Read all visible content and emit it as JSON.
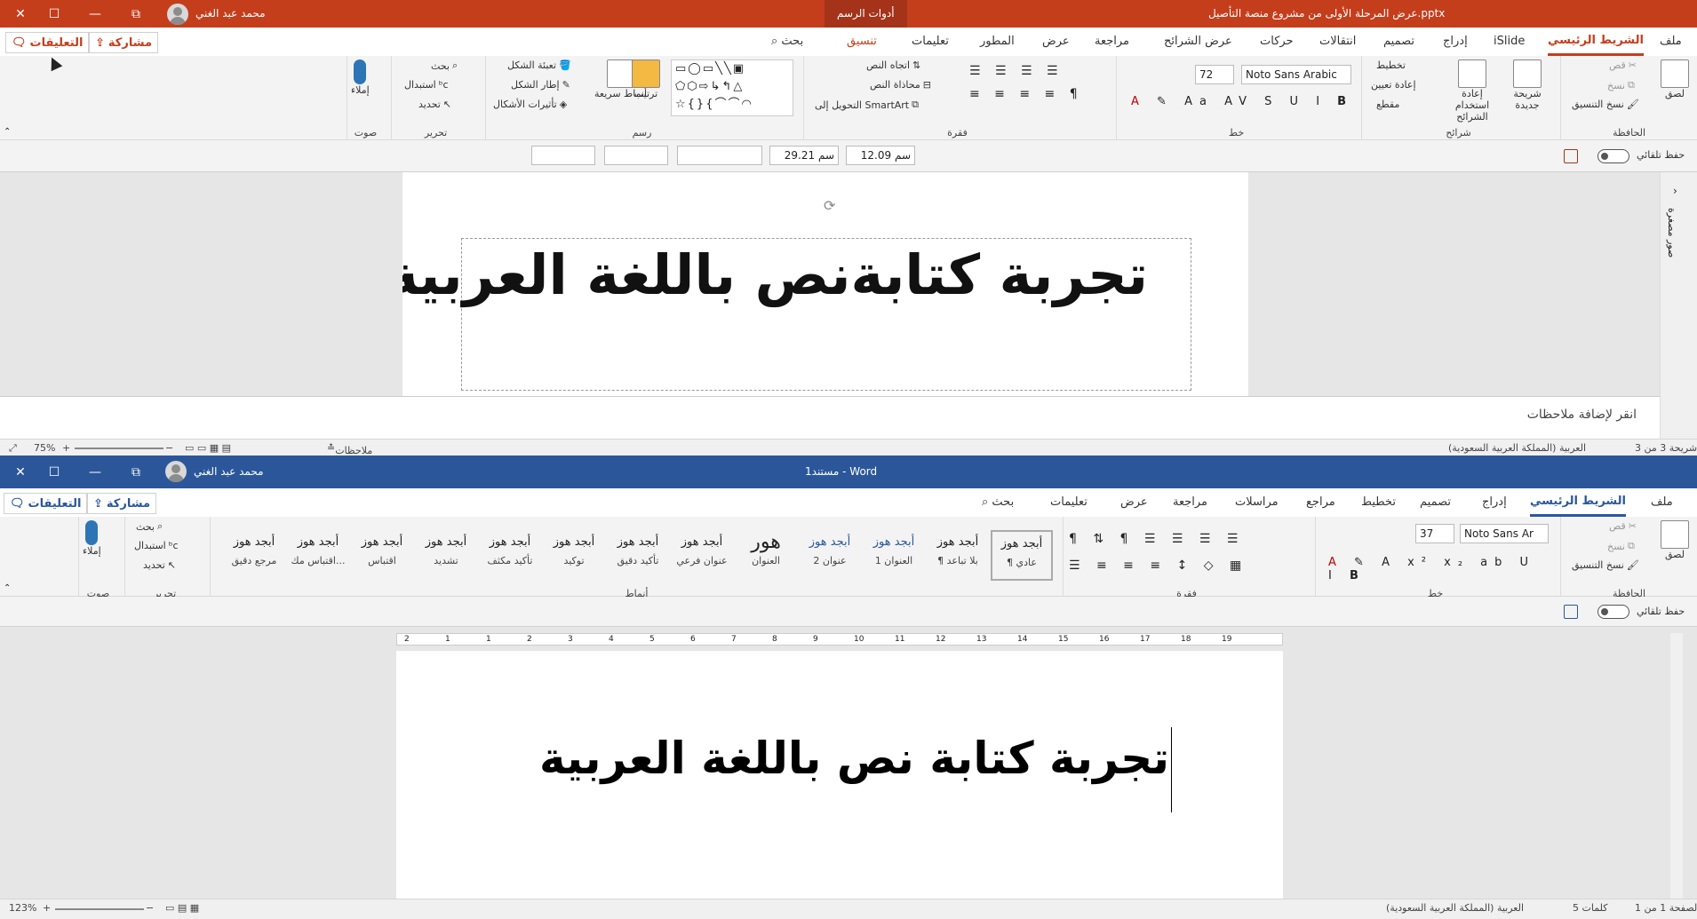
{
  "ppt": {
    "title": "عرض المرحلة الأولى من مشروع منصة التأصيل.pptx",
    "user": "محمد عبد الغني",
    "context_tab": "أدوات الرسم",
    "tabs": [
      "ملف",
      "الشريط الرئيسي",
      "iSlide",
      "إدراج",
      "تصميم",
      "انتقالات",
      "حركات",
      "عرض الشرائح",
      "مراجعة",
      "عرض",
      "المطور",
      "تعليمات",
      "تنسيق"
    ],
    "search": "بحث",
    "share": "مشاركة",
    "comments": "التعليقات",
    "groups": {
      "clipboard": {
        "label": "الحافظة",
        "paste": "لصق",
        "cut": "قص",
        "copy": "نسخ",
        "format_painter": "نسخ التنسيق"
      },
      "slides": {
        "label": "شرائح",
        "new_slide": "شريحة جديدة",
        "reuse": "إعادة استخدام الشرائح",
        "layout": "تخطيط",
        "reset": "إعادة تعيين",
        "section": "مقطع"
      },
      "font": {
        "label": "خط",
        "font_name": "Noto Sans Arabic",
        "font_size": "72"
      },
      "paragraph": {
        "label": "فقرة",
        "text_direction": "اتجاه النص",
        "align_text": "محاذاة النص",
        "smartart": "التحويل إلى SmartArt"
      },
      "drawing": {
        "label": "رسم",
        "arrange": "ترتيب",
        "quick_styles": "أنماط سريعة",
        "shape_fill": "تعبئة الشكل",
        "shape_outline": "إطار الشكل",
        "shape_effects": "تأثيرات الأشكال"
      },
      "editing": {
        "label": "تحرير",
        "find": "بحث",
        "replace": "استبدال",
        "select": "تحديد"
      },
      "voice": {
        "label": "صوت",
        "dictate": "إملاء"
      }
    },
    "qat": {
      "autosave": "حفظ تلقائي",
      "width": "29.21 سم",
      "height": "12.09 سم"
    },
    "slide_text": "تجربة كتابةنص   باللغة العربية",
    "notes_placeholder": "انقر لإضافة ملاحظات",
    "status": {
      "slide": "شريحة 3 من 3",
      "lang": "العربية (المملكة العربية السعودية)",
      "notes": "ملاحظات",
      "zoom": "75%"
    },
    "thumbnails_label": "صور مصغرة"
  },
  "word": {
    "title": "مستند1 - Word",
    "user": "محمد عبد الغني",
    "tabs": [
      "ملف",
      "الشريط الرئيسي",
      "إدراج",
      "تصميم",
      "تخطيط",
      "مراجع",
      "مراسلات",
      "مراجعة",
      "عرض",
      "تعليمات"
    ],
    "search": "بحث",
    "share": "مشاركة",
    "comments": "التعليقات",
    "groups": {
      "clipboard": {
        "label": "الحافظة",
        "paste": "لصق",
        "cut": "قص",
        "copy": "نسخ",
        "format_painter": "نسخ التنسيق"
      },
      "font": {
        "label": "خط",
        "font_name": "Noto Sans Ar",
        "font_size": "37"
      },
      "paragraph": {
        "label": "فقرة"
      },
      "styles": {
        "label": "أنماط",
        "items": [
          {
            "preview": "أبجد هوز",
            "name": "¶ عادي"
          },
          {
            "preview": "أبجد هوز",
            "name": "¶ بلا تباعد"
          },
          {
            "preview": "أبجد هوز",
            "name": "العنوان 1"
          },
          {
            "preview": "أبجد هوز",
            "name": "عنوان 2"
          },
          {
            "preview": "هور",
            "name": "العنوان"
          },
          {
            "preview": "أبجد هوز",
            "name": "عنوان فرعي"
          },
          {
            "preview": "أبجد هوز",
            "name": "تأكيد دقيق"
          },
          {
            "preview": "أبجد هوز",
            "name": "توكيد"
          },
          {
            "preview": "أبجد هوز",
            "name": "تأكيد مكثف"
          },
          {
            "preview": "أبجد هوز",
            "name": "تشديد"
          },
          {
            "preview": "أبجد هوز",
            "name": "اقتباس"
          },
          {
            "preview": "أبجد هوز",
            "name": "اقتباس مك..."
          },
          {
            "preview": "أبجد هوز",
            "name": "مرجع دقيق"
          }
        ]
      },
      "editing": {
        "label": "تحرير",
        "find": "بحث",
        "replace": "استبدال",
        "select": "تحديد"
      },
      "voice": {
        "label": "صوت",
        "dictate": "إملاء"
      }
    },
    "qat": {
      "autosave": "حفظ تلقائي"
    },
    "ruler_numbers": [
      "2",
      "1",
      "1",
      "2",
      "3",
      "4",
      "5",
      "6",
      "7",
      "8",
      "9",
      "10",
      "11",
      "12",
      "13",
      "14",
      "15",
      "16",
      "17",
      "18",
      "19"
    ],
    "doc_text": "تجربة كتابة نص باللغة العربية",
    "status": {
      "page": "الصفحة 1 من 1",
      "words": "5 كلمات",
      "lang": "العربية (المملكة العربية السعودية)",
      "zoom": "123%"
    }
  },
  "colors": {
    "ppt_accent": "#c43e1c",
    "word_accent": "#2b579a"
  }
}
